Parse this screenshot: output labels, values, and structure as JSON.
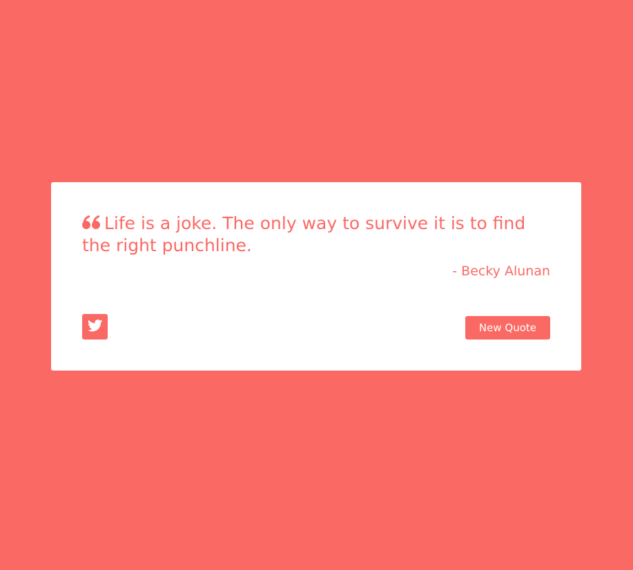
{
  "colors": {
    "background": "#FB6964",
    "card": "#ffffff",
    "accent": "#FB6964"
  },
  "quote": {
    "icon": "quote-left-icon",
    "text": "Life is a joke. The only way to survive it is to find the right punchline.",
    "author": "- Becky Alunan"
  },
  "actions": {
    "tweet_icon": "twitter-icon",
    "new_quote_label": "New Quote"
  }
}
